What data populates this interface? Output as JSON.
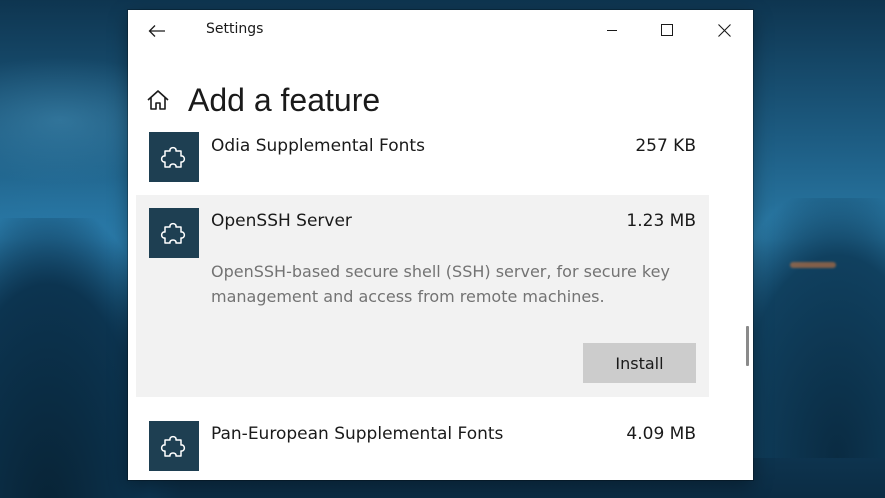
{
  "window": {
    "title": "Settings"
  },
  "page": {
    "title": "Add a feature"
  },
  "features": [
    {
      "name": "Odia Supplemental Fonts",
      "size": "257 KB"
    },
    {
      "name": "OpenSSH Server",
      "size": "1.23 MB",
      "description": "OpenSSH-based secure shell (SSH) server, for secure key management and access from remote machines.",
      "install_label": "Install"
    },
    {
      "name": "Pan-European Supplemental Fonts",
      "size": "4.09 MB"
    }
  ],
  "icons": {
    "back": "back-arrow-icon",
    "minimize": "minimize-icon",
    "maximize": "maximize-icon",
    "close": "close-icon",
    "home": "home-icon",
    "feature": "puzzle-piece-icon"
  },
  "colors": {
    "feature_icon_bg": "#1e3f52",
    "expanded_bg": "#f2f2f2",
    "install_button_bg": "#cccccc",
    "description_text": "#737373"
  }
}
